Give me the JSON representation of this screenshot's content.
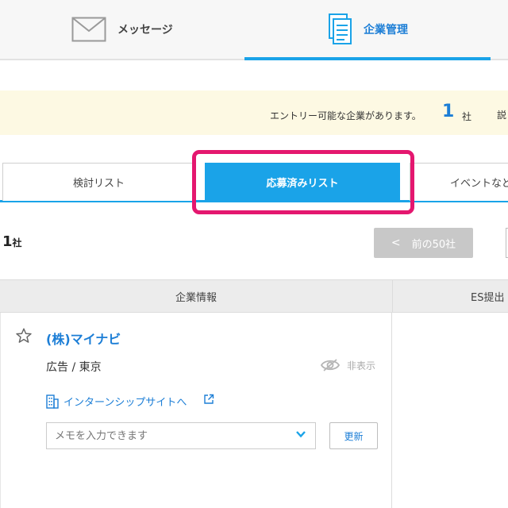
{
  "nav": {
    "message_label": "メッセージ",
    "company_label": "企業管理",
    "active_color": "#1aa3e8"
  },
  "notice": {
    "text": "エントリー可能な企業があります。",
    "count": "1",
    "unit": "社",
    "more": "説"
  },
  "tabs": {
    "items": [
      {
        "label": "検討リスト"
      },
      {
        "label": "応募済みリスト"
      },
      {
        "label": "イベントなど"
      }
    ],
    "active_index": 1,
    "highlight_color": "#e4176f"
  },
  "results": {
    "count": "1",
    "unit": "社",
    "prev_label": "前の50社"
  },
  "table": {
    "headers": [
      "企業情報",
      "ES提出"
    ]
  },
  "company": {
    "name": "(株)マイナビ",
    "meta": "広告 / 東京",
    "hide_label": "非表示",
    "internship_link": "インターンシップサイトへ",
    "memo_placeholder": "メモを入力できます",
    "update_label": "更新"
  },
  "icons": {
    "message": "envelope-icon",
    "company": "document-icon",
    "star": "star-outline-icon",
    "hide": "eye-slash-icon",
    "building": "building-icon",
    "external": "external-link-icon",
    "chevron": "chevron-down-icon"
  }
}
